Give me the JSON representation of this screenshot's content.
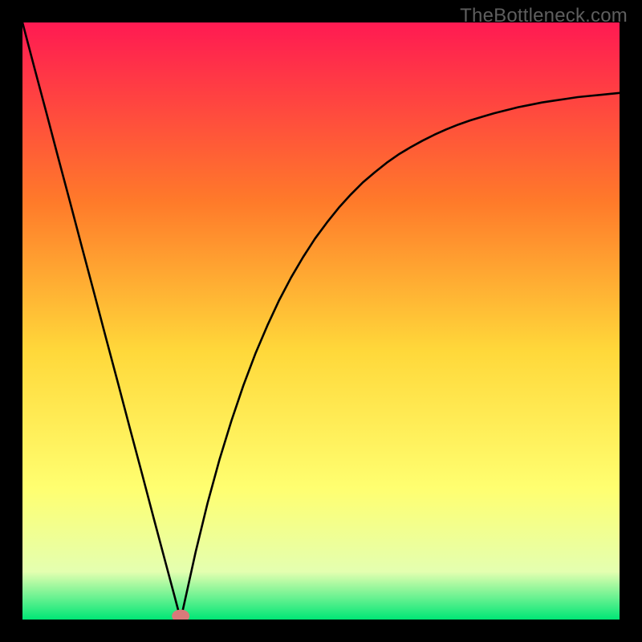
{
  "watermark": "TheBottleneck.com",
  "chart_data": {
    "type": "line",
    "title": "",
    "xlabel": "",
    "ylabel": "",
    "xlim": [
      0,
      1
    ],
    "ylim": [
      0,
      1
    ],
    "legend": false,
    "grid": false,
    "background_gradient": {
      "top": "#ff1a52",
      "mid1": "#ff7a2a",
      "mid2": "#ffd83a",
      "mid3": "#ffff70",
      "mid4": "#e4ffb0",
      "bottom": "#00e676"
    },
    "marker": {
      "x": 0.265,
      "y": 0.006,
      "color": "#d97a7a",
      "size": 11
    },
    "series": [
      {
        "name": "curve",
        "color": "#000000",
        "x": [
          0.0,
          0.02,
          0.04,
          0.06,
          0.08,
          0.1,
          0.12,
          0.14,
          0.16,
          0.18,
          0.2,
          0.22,
          0.24,
          0.255,
          0.265,
          0.275,
          0.29,
          0.31,
          0.33,
          0.35,
          0.37,
          0.39,
          0.41,
          0.43,
          0.45,
          0.47,
          0.49,
          0.51,
          0.53,
          0.55,
          0.57,
          0.59,
          0.61,
          0.63,
          0.65,
          0.67,
          0.69,
          0.71,
          0.73,
          0.75,
          0.77,
          0.79,
          0.81,
          0.83,
          0.85,
          0.87,
          0.89,
          0.91,
          0.93,
          0.95,
          0.97,
          0.99,
          1.0
        ],
        "y": [
          1.0,
          0.924,
          0.849,
          0.773,
          0.698,
          0.622,
          0.547,
          0.471,
          0.396,
          0.32,
          0.245,
          0.169,
          0.094,
          0.038,
          0.0,
          0.045,
          0.113,
          0.195,
          0.268,
          0.333,
          0.392,
          0.445,
          0.492,
          0.535,
          0.573,
          0.607,
          0.638,
          0.665,
          0.69,
          0.712,
          0.732,
          0.749,
          0.765,
          0.779,
          0.791,
          0.802,
          0.812,
          0.821,
          0.829,
          0.836,
          0.842,
          0.848,
          0.853,
          0.858,
          0.862,
          0.866,
          0.869,
          0.872,
          0.875,
          0.877,
          0.879,
          0.881,
          0.882
        ]
      }
    ]
  }
}
